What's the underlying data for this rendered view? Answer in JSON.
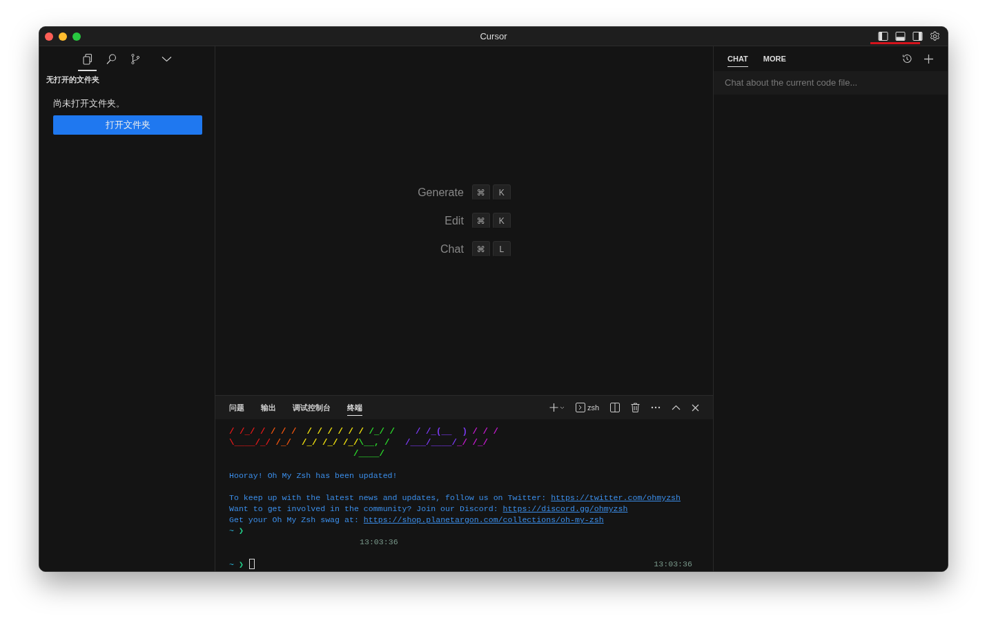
{
  "window": {
    "title": "Cursor"
  },
  "title_bar_toggles": [
    {
      "kind": "left"
    },
    {
      "kind": "bottom"
    },
    {
      "kind": "right"
    },
    {
      "kind": "settings"
    }
  ],
  "sidebar": {
    "tabs": [
      {
        "kind": "files",
        "selected": true
      },
      {
        "kind": "search",
        "selected": false
      },
      {
        "kind": "branch",
        "selected": false
      },
      {
        "kind": "chevron",
        "selected": false
      }
    ],
    "heading": "无打开的文件夹",
    "message": "尚未打开文件夹。",
    "button": "打开文件夹"
  },
  "editor": {
    "shortcuts": [
      {
        "label": "Generate",
        "keys": [
          "⌘",
          "K"
        ]
      },
      {
        "label": "Edit",
        "keys": [
          "⌘",
          "K"
        ]
      },
      {
        "label": "Chat",
        "keys": [
          "⌘",
          "L"
        ]
      }
    ]
  },
  "panel": {
    "tabs": [
      {
        "label": "问题",
        "selected": false
      },
      {
        "label": "输出",
        "selected": false
      },
      {
        "label": "调试控制台",
        "selected": false
      },
      {
        "label": "终端",
        "selected": true
      }
    ],
    "shell": "zsh",
    "terminal": [
      {
        "kind": "art",
        "segments": [
          {
            "text": "/ /_/ /",
            "color": "#e51919"
          },
          {
            "text": " / / /",
            "color": "#f2540f"
          },
          {
            "text": "  / / / / / /",
            "color": "#f2e20f"
          },
          {
            "text": " /_/ /",
            "color": "#2bd92b"
          },
          {
            "text": "    / /_(__  )",
            "color": "#7a3af0"
          },
          {
            "text": " / / /",
            "color": "#c51bd0"
          }
        ]
      },
      {
        "kind": "art",
        "segments": [
          {
            "text": "\\____/_/",
            "color": "#e51919"
          },
          {
            "text": " /_/",
            "color": "#f2540f"
          },
          {
            "text": "  /_/ /_/ /_/",
            "color": "#f2e20f"
          },
          {
            "text": "\\__, /",
            "color": "#2bd92b"
          },
          {
            "text": "   /___/____/",
            "color": "#7a3af0"
          },
          {
            "text": "_/ /_/",
            "color": "#c51bd0"
          }
        ]
      },
      {
        "kind": "art",
        "segments": [
          {
            "text": "                        /____/",
            "color": "#2bd92b"
          }
        ]
      },
      {
        "kind": "blank"
      },
      {
        "kind": "text",
        "segments": [
          {
            "text": "Hooray! Oh My Zsh has been updated!",
            "link": false
          }
        ]
      },
      {
        "kind": "blank"
      },
      {
        "kind": "text",
        "segments": [
          {
            "text": "To keep up with the latest news and updates, follow us on Twitter: ",
            "link": false
          },
          {
            "text": "https://twitter.com/ohmyzsh",
            "link": true
          }
        ]
      },
      {
        "kind": "text",
        "segments": [
          {
            "text": "Want to get involved in the community? Join our Discord: ",
            "link": false
          },
          {
            "text": "https://discord.gg/ohmyzsh",
            "link": true
          }
        ]
      },
      {
        "kind": "text",
        "segments": [
          {
            "text": "Get your Oh My Zsh swag at: ",
            "link": false
          },
          {
            "text": "https://shop.planetargon.com/collections/oh-my-zsh",
            "link": true
          }
        ]
      },
      {
        "kind": "prompt",
        "dir": "~",
        "arrow": "❯",
        "cursor": false
      },
      {
        "kind": "time",
        "text": "13:03:36"
      },
      {
        "kind": "prompt",
        "dir": "~",
        "arrow": "❯",
        "cursor": true,
        "time": "13:03:36"
      }
    ]
  },
  "chat": {
    "tabs": [
      {
        "label": "CHAT",
        "selected": true
      },
      {
        "label": "MORE",
        "selected": false
      }
    ],
    "placeholder": "Chat about the current code file..."
  }
}
